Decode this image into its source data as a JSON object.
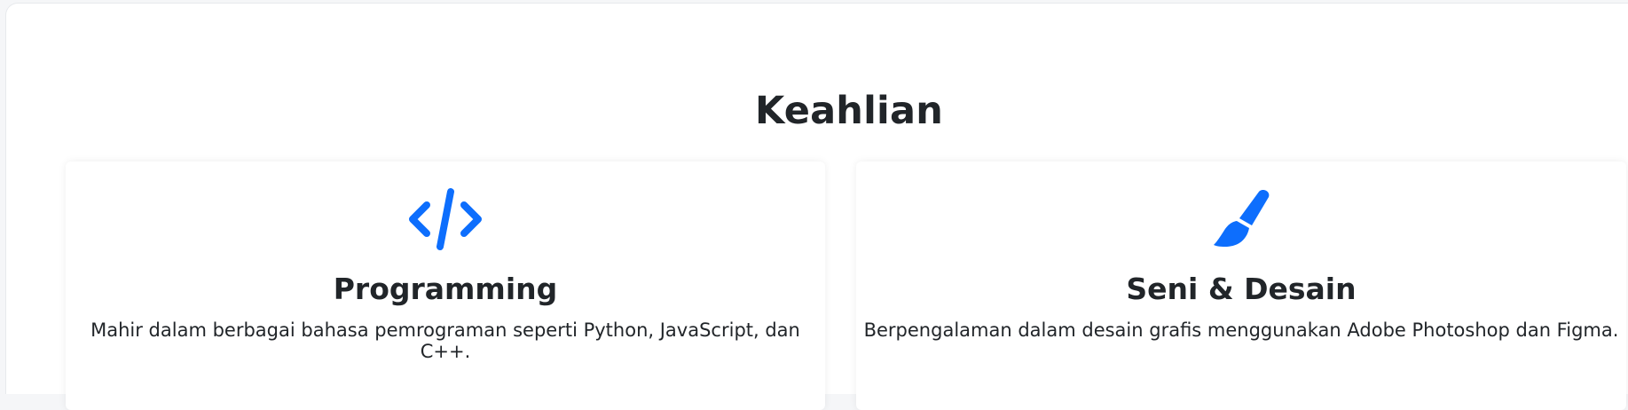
{
  "section": {
    "title": "Keahlian"
  },
  "cards": [
    {
      "icon": "code-icon",
      "title": "Programming",
      "description": "Mahir dalam berbagai bahasa pemrograman seperti Python, JavaScript, dan C++."
    },
    {
      "icon": "brush-icon",
      "title": "Seni & Desain",
      "description": "Berpengalaman dalam desain grafis menggunakan Adobe Photoshop dan Figma."
    }
  ],
  "colors": {
    "accent": "#0d6efd",
    "text": "#212529",
    "background": "#ffffff",
    "page": "#f5f6f8"
  }
}
